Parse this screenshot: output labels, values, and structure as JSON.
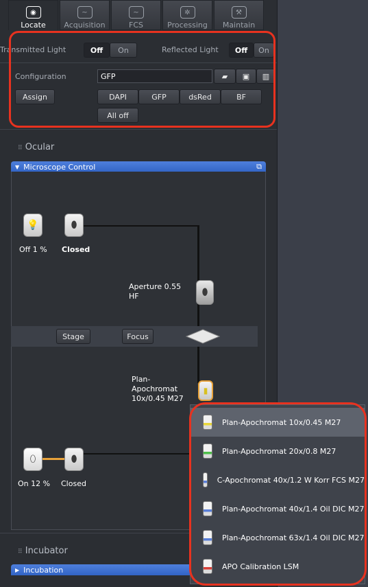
{
  "tabs": [
    {
      "label": "Locate",
      "icon": "eye-icon",
      "active": true
    },
    {
      "label": "Acquisition",
      "icon": "acquisition-icon"
    },
    {
      "label": "FCS",
      "icon": "fcs-icon"
    },
    {
      "label": "Processing",
      "icon": "gear-icon"
    },
    {
      "label": "Maintain",
      "icon": "wrench-icon"
    }
  ],
  "light": {
    "transmitted_label": "Transmitted Light",
    "reflected_label": "Reflected Light",
    "off": "Off",
    "on": "On"
  },
  "configuration": {
    "label": "Configuration",
    "value": "GFP",
    "assign": "Assign",
    "presets": [
      "DAPI",
      "GFP",
      "dsRed",
      "BF"
    ],
    "all_off": "All off"
  },
  "sections": {
    "ocular": "Ocular",
    "incubator": "Incubator"
  },
  "microscope_control": {
    "title": "Microscope Control",
    "top_lamp_status": "Off 1 %",
    "top_shutter_status": "Closed",
    "aperture_text": "Aperture 0.55\nHF",
    "stage": "Stage",
    "focus": "Focus",
    "objective_text": "Plan-\nApochromat\n10x/0.45 M27",
    "bottom_lamp_status": "On 12 %",
    "bottom_shutter_status": "Closed"
  },
  "incubation": {
    "title": "Incubation"
  },
  "objectives": [
    {
      "label": "Plan-Apochromat 10x/0.45 M27",
      "color": "#e8d73a",
      "selected": true
    },
    {
      "label": "Plan-Apochromat 20x/0.8 M27",
      "color": "#4dbf4a"
    },
    {
      "label": "C-Apochromat 40x/1.2 W Korr FCS M27",
      "color": "#5a7fd8"
    },
    {
      "label": "Plan-Apochromat 40x/1.4 Oil DIC M27",
      "color": "#5a7fd8"
    },
    {
      "label": "Plan-Apochromat 63x/1.4 Oil DIC M27",
      "color": "#5a7fd8"
    },
    {
      "label": "APO Calibration LSM",
      "color": "#d8403a"
    }
  ],
  "colors": {
    "highlight": "#e8321f",
    "accent_blue": "#3a6ed0"
  }
}
